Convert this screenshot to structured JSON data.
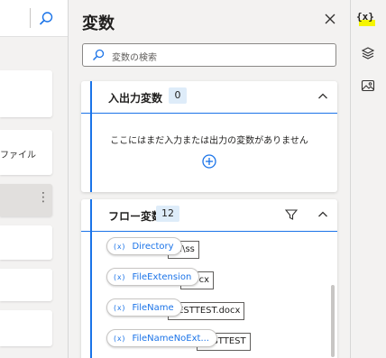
{
  "left_pane": {
    "snippet_text": "ファイル",
    "more_glyph": "⋮"
  },
  "panel": {
    "title": "変数",
    "search": {
      "placeholder": "変数の検索"
    },
    "io_section": {
      "title": "入出力変数",
      "count": "0",
      "empty_message": "ここにはまだ入力または出力の変数がありません"
    },
    "flow_section": {
      "title": "フロー変数",
      "count": "12",
      "variables": [
        {
          "prefix": "(x)",
          "name": "Directory",
          "value": "D:\\ss"
        },
        {
          "prefix": "(x)",
          "name": "FileExtension",
          "value": ".docx"
        },
        {
          "prefix": "(x)",
          "name": "FileName",
          "value": "TESTTEST.docx"
        },
        {
          "prefix": "(x)",
          "name": "FileNameNoExt...",
          "value": "TESTTEST"
        }
      ]
    }
  },
  "rail": {
    "variables_label": "{x}"
  },
  "colors": {
    "accent": "#1a73e8",
    "highlight": "#f5f500",
    "count_bg": "#deecf9"
  }
}
